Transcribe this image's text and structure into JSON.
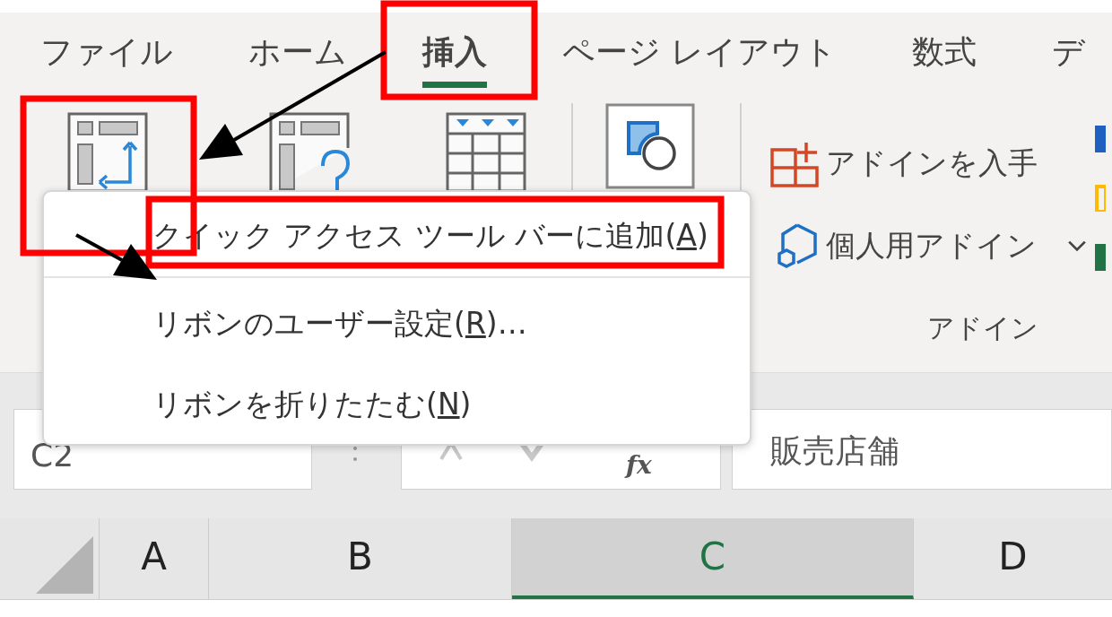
{
  "tabs": [
    {
      "label": "ファイル",
      "selected": false
    },
    {
      "label": "ホーム",
      "selected": false
    },
    {
      "label": "挿入",
      "selected": true
    },
    {
      "label": "ページ レイアウト",
      "selected": false
    },
    {
      "label": "数式",
      "selected": false
    },
    {
      "label": "デ",
      "selected": false
    }
  ],
  "ribbon": {
    "addin_buttons": [
      {
        "label": "アドインを入手",
        "kind": "store",
        "dropdown": false
      },
      {
        "label": "個人用アドイン",
        "kind": "personal",
        "dropdown": true
      }
    ],
    "group_label": "アドイン"
  },
  "context_menu": {
    "items": [
      {
        "text": "クイック アクセス ツール バーに追加(",
        "key": "A",
        "after": ")",
        "separator_after": true
      },
      {
        "text": "リボンのユーザー設定(",
        "key": "R",
        "after": ")…",
        "separator_after": false
      },
      {
        "text": "リボンを折りたたむ(",
        "key": "N",
        "after": ")",
        "separator_after": false
      }
    ]
  },
  "formula_bar": {
    "name_box": "C2",
    "fx": "fx",
    "value": "販売店舗"
  },
  "columns": [
    {
      "label": "A",
      "selected": false
    },
    {
      "label": "B",
      "selected": false
    },
    {
      "label": "C",
      "selected": true
    },
    {
      "label": "D",
      "selected": false
    }
  ]
}
